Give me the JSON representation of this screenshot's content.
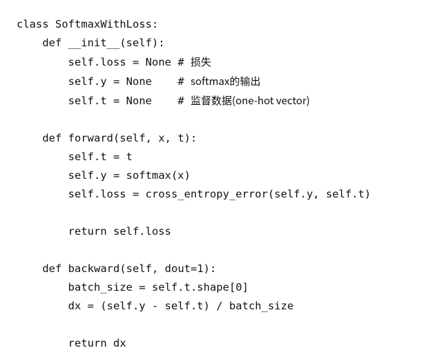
{
  "code": {
    "l1": {
      "kw_class": "class",
      "cls": "SoftmaxWithLoss",
      "colon": ":"
    },
    "l2": {
      "kw_def": "def",
      "fn": "__init__",
      "lp": "(",
      "self": "self",
      "rp": ")",
      "colon": ":"
    },
    "l3": {
      "self": "self",
      "dot": ".",
      "attr": "loss",
      "eq": " = ",
      "val": "None",
      "hash": "# ",
      "comment": "损失"
    },
    "l4": {
      "self": "self",
      "dot": ".",
      "attr": "y",
      "eq": " = ",
      "val": "None",
      "hash": "# ",
      "comment": "softmax的输出"
    },
    "l5": {
      "self": "self",
      "dot": ".",
      "attr": "t",
      "eq": " = ",
      "val": "None",
      "hash": "# ",
      "comment": "监督数据(one-hot vector)"
    },
    "l7": {
      "kw_def": "def",
      "fn": "forward",
      "lp": "(",
      "args": "self, x, t",
      "rp": ")",
      "colon": ":"
    },
    "l8": {
      "lhs": "self.t",
      "eq": " = ",
      "rhs": "t"
    },
    "l9": {
      "lhs": "self.y",
      "eq": " = ",
      "rhs": "softmax(x)"
    },
    "l10": {
      "lhs": "self.loss",
      "eq": " = ",
      "rhs": "cross_entropy_error(self.y, self.t)"
    },
    "l12": {
      "kw_return": "return",
      "expr": " self.loss"
    },
    "l14": {
      "kw_def": "def",
      "fn": "backward",
      "lp": "(",
      "args": "self, dout=1",
      "rp": ")",
      "colon": ":"
    },
    "l15": {
      "lhs": "batch_size",
      "eq": " = ",
      "rhs": "self.t.shape[0]"
    },
    "l16": {
      "lhs": "dx",
      "eq": " = ",
      "rhs": "(self.y - self.t) / batch_size"
    },
    "l18": {
      "kw_return": "return",
      "expr": " dx"
    }
  },
  "chart_data": {
    "type": "code_listing",
    "language": "python",
    "lines": [
      "class SoftmaxWithLoss:",
      "    def __init__(self):",
      "        self.loss = None # 损失",
      "        self.y = None    # softmax的输出",
      "        self.t = None    # 监督数据(one-hot vector)",
      "",
      "    def forward(self, x, t):",
      "        self.t = t",
      "        self.y = softmax(x)",
      "        self.loss = cross_entropy_error(self.y, self.t)",
      "",
      "        return self.loss",
      "",
      "    def backward(self, dout=1):",
      "        batch_size = self.t.shape[0]",
      "        dx = (self.y - self.t) / batch_size",
      "",
      "        return dx"
    ]
  }
}
